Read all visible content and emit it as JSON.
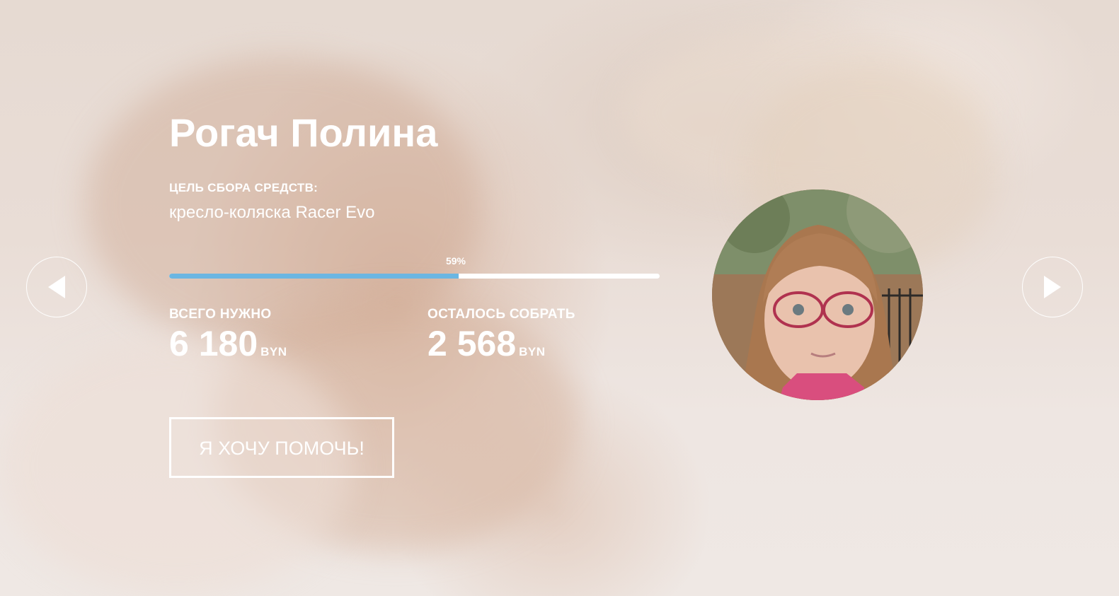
{
  "campaign": {
    "name": "Рогач Полина",
    "goal_label": "ЦЕЛЬ СБОРА СРЕДСТВ:",
    "goal_value": "кресло-коляска Racer Evo",
    "progress": {
      "percent_label": "59%",
      "value": 0.59
    },
    "stats": {
      "total": {
        "label": "ВСЕГО НУЖНО",
        "value": "6 180",
        "currency": "BYN"
      },
      "remaining": {
        "label": "ОСТАЛОСЬ СОБРАТЬ",
        "value": "2 568",
        "currency": "BYN"
      }
    },
    "cta": {
      "label": "Я ХОЧУ ПОМОЧЬ!"
    }
  },
  "navigation": {
    "prev_icon": "triangle-left-icon",
    "next_icon": "triangle-right-icon"
  },
  "colors": {
    "accent": "#6bb6e2",
    "text": "#ffffff",
    "track": "#ffffff"
  }
}
